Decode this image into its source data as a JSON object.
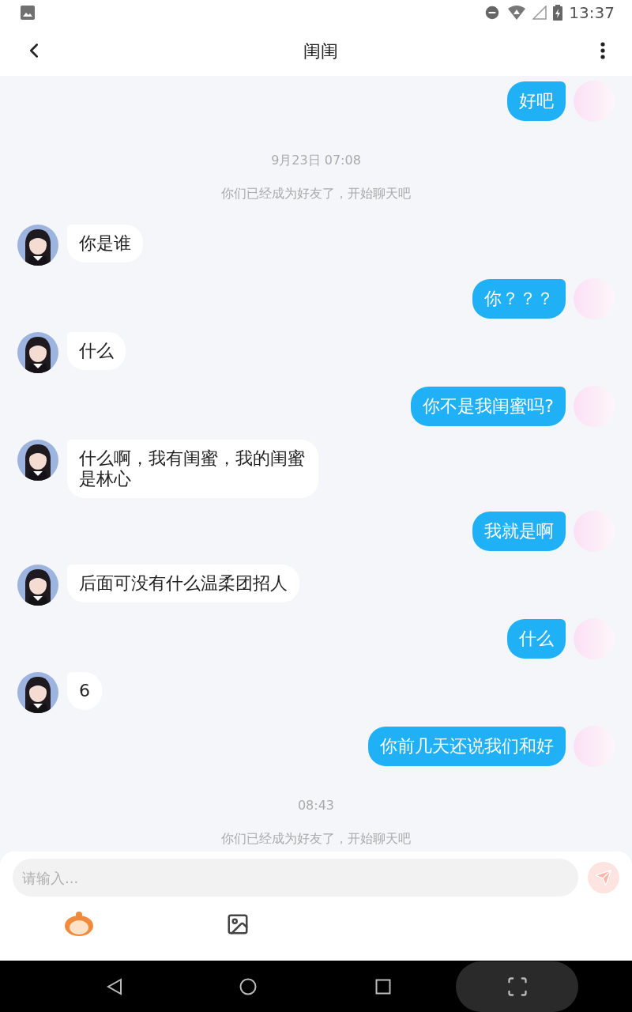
{
  "status_bar": {
    "time": "13:37"
  },
  "header": {
    "title": "闺闺"
  },
  "messages": [
    {
      "kind": "outgoing",
      "text": "好吧"
    },
    {
      "kind": "time",
      "text": "9月23日 07:08"
    },
    {
      "kind": "system",
      "text": "你们已经成为好友了，开始聊天吧"
    },
    {
      "kind": "incoming",
      "text": "你是谁"
    },
    {
      "kind": "outgoing",
      "text": "你？？？"
    },
    {
      "kind": "incoming",
      "text": "什么"
    },
    {
      "kind": "outgoing",
      "text": "你不是我闺蜜吗?"
    },
    {
      "kind": "incoming",
      "text": "什么啊，我有闺蜜，我的闺蜜是林心"
    },
    {
      "kind": "outgoing",
      "text": "我就是啊"
    },
    {
      "kind": "incoming",
      "text": "后面可没有什么温柔团招人"
    },
    {
      "kind": "outgoing",
      "text": "什么"
    },
    {
      "kind": "incoming",
      "text": "6"
    },
    {
      "kind": "outgoing",
      "text": "你前几天还说我们和好"
    },
    {
      "kind": "time",
      "text": "08:43"
    },
    {
      "kind": "system",
      "text": "你们已经成为好友了，开始聊天吧"
    }
  ],
  "composer": {
    "placeholder": "请输入..."
  }
}
